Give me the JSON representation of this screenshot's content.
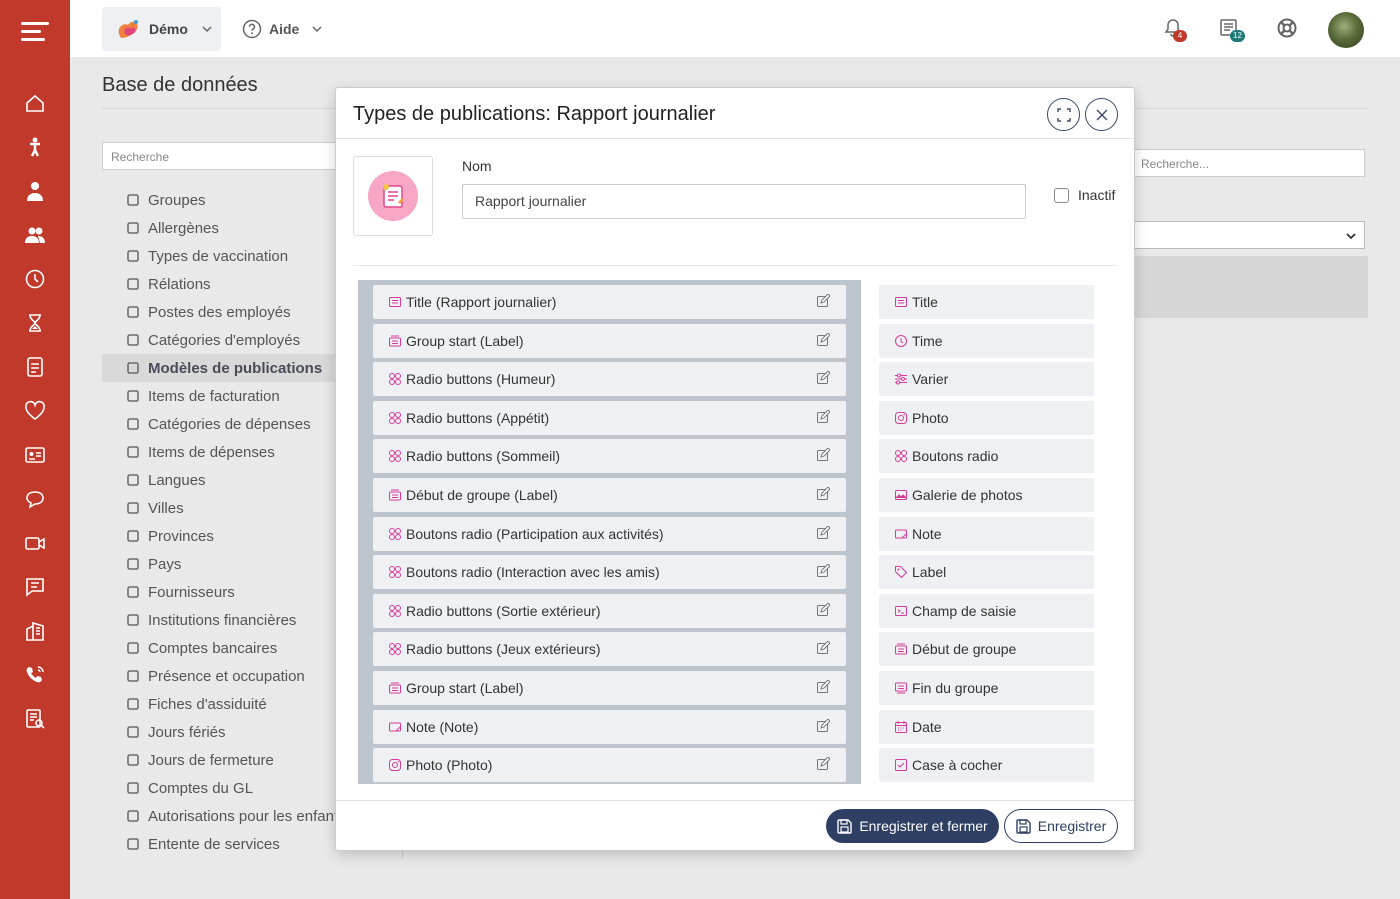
{
  "topbar": {
    "demo_label": "Démo",
    "help_label": "Aide",
    "notifications_count": "4",
    "news_count": "12"
  },
  "colors": {
    "sidebar": "#c0392b",
    "primary_button": "#2e3f63",
    "field_icon": "#d63c9a"
  },
  "page": {
    "title": "Base de données"
  },
  "sidebar_icons": [
    "home-icon",
    "child-icon",
    "staff-icon",
    "users-icon",
    "clock-icon",
    "hourglass-icon",
    "report-icon",
    "heart-icon",
    "id-card-icon",
    "chat-icon",
    "video-icon",
    "message-icon",
    "building-icon",
    "phone-icon",
    "checklist-icon"
  ],
  "left_nav": {
    "search_placeholder": "Recherche",
    "items": [
      {
        "label": "Groupes",
        "icon": "grid-icon"
      },
      {
        "label": "Allergènes",
        "icon": "allergen-icon"
      },
      {
        "label": "Types de vaccination",
        "icon": "syringe-icon"
      },
      {
        "label": "Rélations",
        "icon": "people-icon"
      },
      {
        "label": "Postes des employés",
        "icon": "badge-icon"
      },
      {
        "label": "Catégories d'employés",
        "icon": "person-box-icon"
      },
      {
        "label": "Modèles de publications",
        "icon": "tag-icon"
      },
      {
        "label": "Items de facturation",
        "icon": "list-icon"
      },
      {
        "label": "Catégories de dépenses",
        "icon": "folder-icon"
      },
      {
        "label": "Items de dépenses",
        "icon": "list-icon"
      },
      {
        "label": "Langues",
        "icon": "globe-icon"
      },
      {
        "label": "Villes",
        "icon": "city-icon"
      },
      {
        "label": "Provinces",
        "icon": "p-circle-icon"
      },
      {
        "label": "Pays",
        "icon": "flag-icon"
      },
      {
        "label": "Fournisseurs",
        "icon": "supplier-icon"
      },
      {
        "label": "Institutions financières",
        "icon": "bank-icon"
      },
      {
        "label": "Comptes bancaires",
        "icon": "wallet-icon"
      },
      {
        "label": "Présence et occupation",
        "icon": "table-icon"
      },
      {
        "label": "Fiches d'assiduité",
        "icon": "alarm-icon"
      },
      {
        "label": "Jours fériés",
        "icon": "leaf-icon"
      },
      {
        "label": "Jours de fermeture",
        "icon": "door-icon"
      },
      {
        "label": "Comptes du GL",
        "icon": "list-icon"
      },
      {
        "label": "Autorisations pour les enfants",
        "icon": "exclamation-icon"
      },
      {
        "label": "Entente de services",
        "icon": "book-icon"
      }
    ],
    "active_label": "Modèles de publications"
  },
  "right_bg": {
    "search_placeholder": "Recherche..."
  },
  "modal": {
    "title": "Types de publications: Rapport journalier",
    "name_label": "Nom",
    "name_value": "Rapport journalier",
    "inactive_label": "Inactif",
    "inactive_checked": false,
    "fields": [
      {
        "label": "Title (Rapport journalier)",
        "icon": "title-icon"
      },
      {
        "label": "Group start (Label)",
        "icon": "group-icon"
      },
      {
        "label": "Radio buttons (Humeur)",
        "icon": "radio-icon"
      },
      {
        "label": "Radio buttons (Appétit)",
        "icon": "radio-icon"
      },
      {
        "label": "Radio buttons (Sommeil)",
        "icon": "radio-icon"
      },
      {
        "label": "Début de groupe (Label)",
        "icon": "group-icon"
      },
      {
        "label": "Boutons radio (Participation aux activités)",
        "icon": "radio-icon"
      },
      {
        "label": "Boutons radio (Interaction avec les amis)",
        "icon": "radio-icon"
      },
      {
        "label": "Radio buttons (Sortie extérieur)",
        "icon": "radio-icon"
      },
      {
        "label": "Radio buttons (Jeux extérieurs)",
        "icon": "radio-icon"
      },
      {
        "label": "Group start (Label)",
        "icon": "group-icon"
      },
      {
        "label": "Note (Note)",
        "icon": "note-icon"
      },
      {
        "label": "Photo (Photo)",
        "icon": "photo-icon"
      }
    ],
    "field_types": [
      {
        "label": "Title",
        "icon": "title-icon"
      },
      {
        "label": "Time",
        "icon": "clock-icon"
      },
      {
        "label": "Varier",
        "icon": "sliders-icon"
      },
      {
        "label": "Photo",
        "icon": "photo-icon"
      },
      {
        "label": "Boutons radio",
        "icon": "radio-icon"
      },
      {
        "label": "Galerie de photos",
        "icon": "gallery-icon"
      },
      {
        "label": "Note",
        "icon": "note-icon"
      },
      {
        "label": "Label",
        "icon": "tag-icon"
      },
      {
        "label": "Champ de saisie",
        "icon": "terminal-icon"
      },
      {
        "label": "Début de groupe",
        "icon": "group-icon"
      },
      {
        "label": "Fin du groupe",
        "icon": "group-end-icon"
      },
      {
        "label": "Date",
        "icon": "calendar-icon"
      },
      {
        "label": "Case à cocher",
        "icon": "checkbox-icon"
      }
    ],
    "save_close_label": "Enregistrer et fermer",
    "save_label": "Enregistrer"
  }
}
